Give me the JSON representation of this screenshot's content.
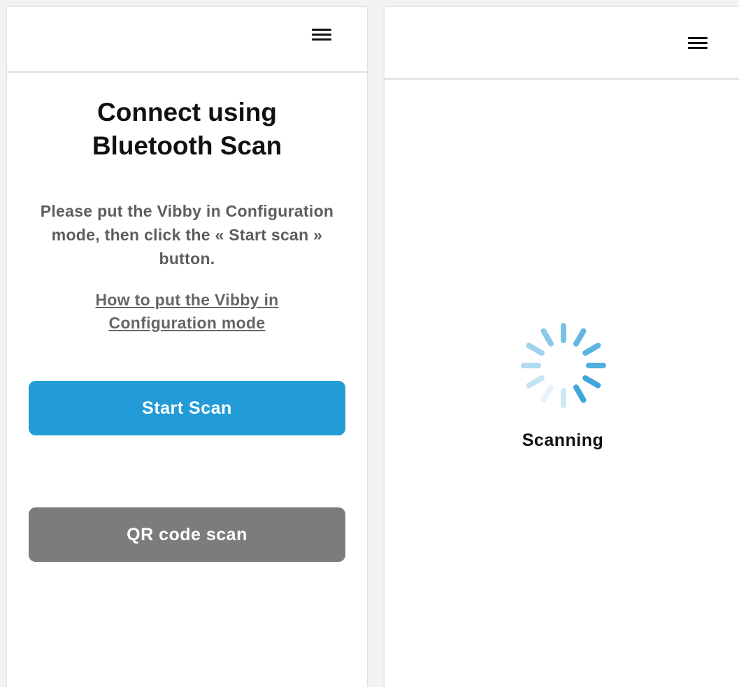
{
  "left_screen": {
    "title": "Connect using Bluetooth Scan",
    "instructions": "Please put the Vibby in Configuration mode, then click the « Start scan » button.",
    "help_link": "How to put the Vibby in Configuration mode",
    "start_button": "Start Scan",
    "qr_button": "QR code scan",
    "menu_icon": "hamburger-menu-icon"
  },
  "right_screen": {
    "status": "Scanning",
    "spinner_icon": "loading-spinner-icon",
    "menu_icon": "hamburger-menu-icon"
  },
  "colors": {
    "primary_button": "#239bd6",
    "secondary_button": "#7c7c7c",
    "spinner": "#3fa6dc",
    "instruction_text": "#5d5d5d"
  }
}
